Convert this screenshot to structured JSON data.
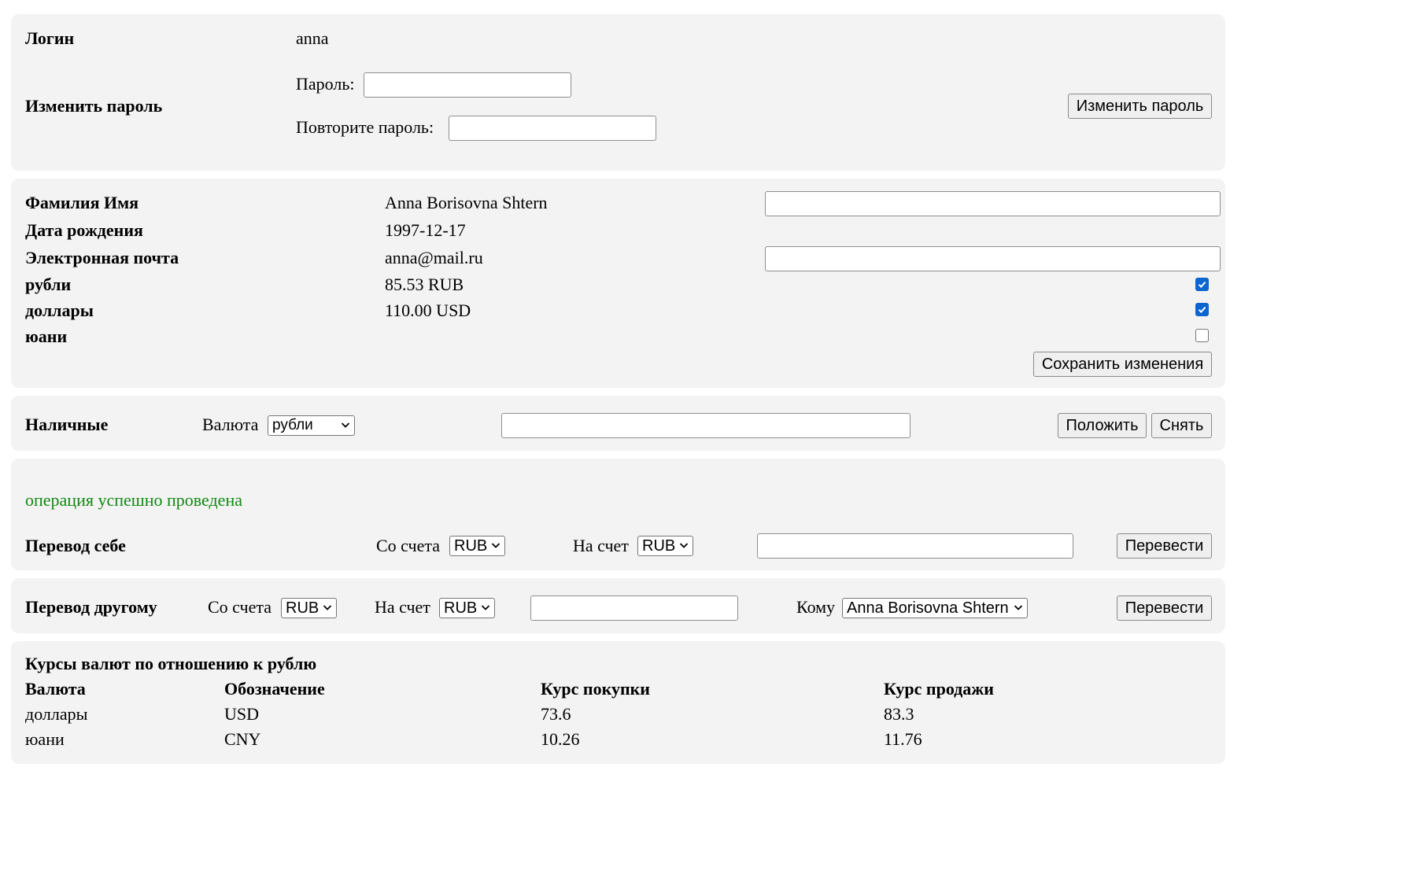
{
  "login": {
    "label": "Логин",
    "value": "anna"
  },
  "password": {
    "section_label": "Изменить пароль",
    "password_label": "Пароль:",
    "password_value": "",
    "repeat_label": "Повторите пароль:",
    "repeat_value": "",
    "button": "Изменить пароль"
  },
  "profile": {
    "fullname_label": "Фамилия Имя",
    "fullname_value": "Anna Borisovna Shtern",
    "fullname_input": "",
    "birthdate_label": "Дата рождения",
    "birthdate_value": "1997-12-17",
    "email_label": "Электронная почта",
    "email_value": "anna@mail.ru",
    "email_input": "",
    "accounts": [
      {
        "label": "рубли",
        "value": "85.53 RUB",
        "checked": true
      },
      {
        "label": "доллары",
        "value": "110.00 USD",
        "checked": true
      },
      {
        "label": "юани",
        "value": "",
        "checked": false
      }
    ],
    "save_button": "Сохранить изменения"
  },
  "cash": {
    "title": "Наличные",
    "currency_label": "Валюта",
    "currency_selected": "рубли",
    "amount": "",
    "deposit_button": "Положить",
    "withdraw_button": "Снять"
  },
  "self_transfer": {
    "status_message": "операция успешно проведена",
    "status_color": "#118811",
    "title": "Перевод себе",
    "from_label": "Со счета",
    "from_selected": "RUB",
    "to_label": "На счет",
    "to_selected": "RUB",
    "amount": "",
    "button": "Перевести"
  },
  "other_transfer": {
    "title": "Перевод другому",
    "from_label": "Со счета",
    "from_selected": "RUB",
    "to_label": "На счет",
    "to_selected": "RUB",
    "amount": "",
    "recipient_label": "Кому",
    "recipient_selected": "Anna Borisovna Shtern",
    "button": "Перевести"
  },
  "rates": {
    "title": "Курсы валют по отношению к рублю",
    "headers": [
      "Валюта",
      "Обозначение",
      "Курс покупки",
      "Курс продажи"
    ],
    "rows": [
      [
        "доллары",
        "USD",
        "73.6",
        "83.3"
      ],
      [
        "юани",
        "CNY",
        "10.26",
        "11.76"
      ]
    ]
  },
  "colors": {
    "panel_background": "#f3f3f3",
    "checkbox_checked": "#0b66d0"
  },
  "icons": {
    "select_arrow": "chevron-down-icon",
    "check_mark": "check-icon"
  }
}
